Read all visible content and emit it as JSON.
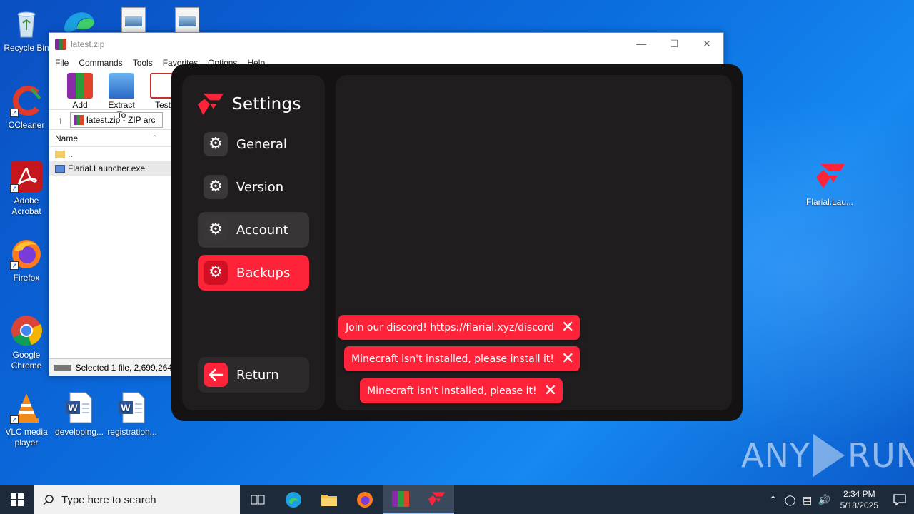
{
  "desktop": {
    "icons": [
      {
        "label": "Recycle Bin"
      },
      {
        "label": "CCleaner"
      },
      {
        "label": "Adobe Acrobat"
      },
      {
        "label": "Firefox"
      },
      {
        "label": "Google Chrome"
      },
      {
        "label": "VLC media player"
      },
      {
        "label": "developing..."
      },
      {
        "label": "registration..."
      },
      {
        "label": "Flarial.Lau..."
      }
    ],
    "watermark": {
      "left": "ANY",
      "right": "RUN"
    }
  },
  "winrar": {
    "title": "latest.zip",
    "menu": [
      "File",
      "Commands",
      "Tools",
      "Favorites",
      "Options",
      "Help"
    ],
    "toolbar": [
      {
        "label": "Add"
      },
      {
        "label": "Extract To"
      },
      {
        "label": "Test"
      }
    ],
    "path": "latest.zip - ZIP arc",
    "column_name": "Name",
    "rows": [
      {
        "name": ".."
      },
      {
        "name": "Flarial.Launcher.exe"
      }
    ],
    "status": "Selected 1 file, 2,699,264"
  },
  "flarial": {
    "title": "Settings",
    "nav": [
      {
        "label": "General",
        "icon": "gear-icon"
      },
      {
        "label": "Version",
        "icon": "gear-icon"
      },
      {
        "label": "Account",
        "icon": "gear-icon"
      },
      {
        "label": "Backups",
        "icon": "gear-icon"
      }
    ],
    "return_label": "Return",
    "toasts": [
      {
        "text": "Join our discord! https://flarial.xyz/discord"
      },
      {
        "text": "Minecraft isn't installed, please install it!"
      },
      {
        "text": "Minecraft isn't installed, please it!"
      }
    ],
    "colors": {
      "accent": "#ff233a",
      "panel": "#201d1e",
      "bg": "#141213"
    }
  },
  "taskbar": {
    "search_placeholder": "Type here to search",
    "time": "2:34 PM",
    "date": "5/18/2025"
  }
}
